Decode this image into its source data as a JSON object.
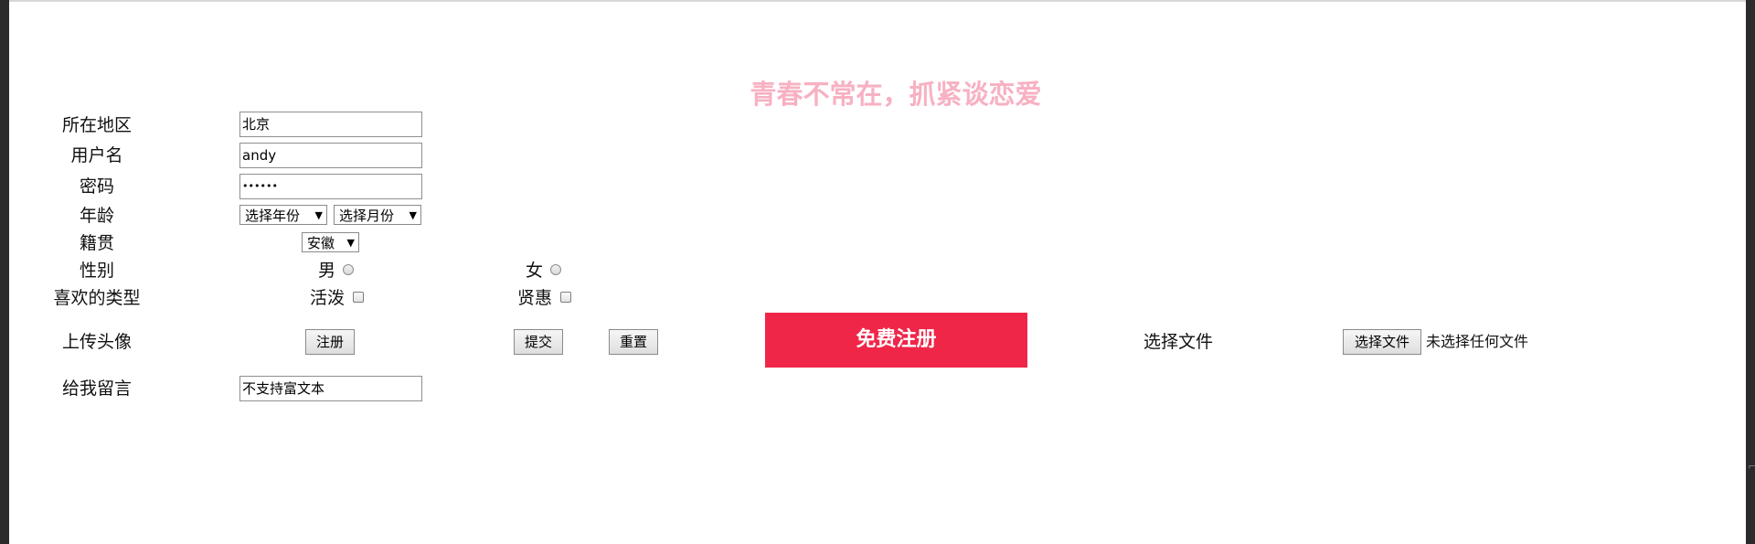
{
  "title": "青春不常在，抓紧谈恋爱",
  "form": {
    "region": {
      "label": "所在地区",
      "value": "北京"
    },
    "username": {
      "label": "用户名",
      "value": "andy"
    },
    "password": {
      "label": "密码",
      "value": "••••••"
    },
    "age": {
      "label": "年龄",
      "year_select": "选择年份",
      "month_select": "选择月份"
    },
    "hometown": {
      "label": "籍贯",
      "select": "安徽"
    },
    "gender": {
      "label": "性别",
      "male": "男",
      "female": "女"
    },
    "liked_type": {
      "label": "喜欢的类型",
      "option1": "活泼",
      "option2": "贤惠"
    },
    "avatar": {
      "label": "上传头像"
    },
    "buttons": {
      "register": "注册",
      "submit": "提交",
      "reset": "重置",
      "free_register": "免费注册"
    },
    "file": {
      "label": "选择文件",
      "button": "选择文件",
      "status": "未选择任何文件"
    },
    "message": {
      "label": "给我留言",
      "value": "不支持富文本"
    }
  },
  "colors": {
    "title": "#f7b1c2",
    "free_register_bg": "#f02648"
  }
}
